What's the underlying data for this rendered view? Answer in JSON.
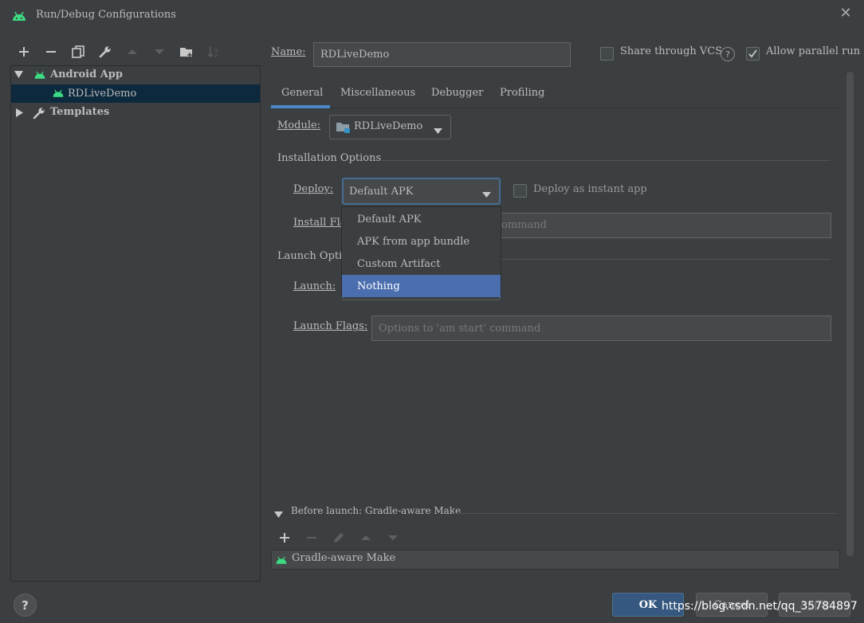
{
  "window": {
    "title": "Run/Debug Configurations"
  },
  "tree": {
    "group_label": "Android App",
    "item_label": "RDLiveDemo",
    "templates_label": "Templates"
  },
  "header": {
    "name_label": "Name:",
    "name_value": "RDLiveDemo",
    "share_vcs_label": "Share through VCS",
    "share_vcs_checked": false,
    "allow_parallel_label": "Allow parallel run",
    "allow_parallel_checked": true
  },
  "tabs": [
    {
      "label": "General",
      "active": true
    },
    {
      "label": "Miscellaneous",
      "active": false
    },
    {
      "label": "Debugger",
      "active": false
    },
    {
      "label": "Profiling",
      "active": false
    }
  ],
  "general": {
    "module_label": "Module:",
    "module_value": "RDLiveDemo",
    "installation_options_label": "Installation Options",
    "deploy_label": "Deploy:",
    "deploy_value": "Default APK",
    "deploy_instant_label": "Deploy as instant app",
    "install_flags_label": "Install Fla",
    "install_flags_placeholder_tail": "ommand",
    "launch_options_label": "Launch Optio",
    "launch_label": "Launch:",
    "launch_flags_label": "Launch Flags:",
    "launch_flags_placeholder": "Options to 'am start' command",
    "deploy_options": [
      "Default APK",
      "APK from app bundle",
      "Custom Artifact",
      "Nothing"
    ],
    "deploy_options_selected": "Nothing"
  },
  "before_launch": {
    "title": "Before launch: Gradle-aware Make",
    "tasks": [
      "Gradle-aware Make"
    ]
  },
  "buttons": {
    "ok": "OK",
    "cancel": "Cancel",
    "apply": "Apply",
    "help": "?"
  },
  "watermark": "https://blog.csdn.net/qq_35784897",
  "colors": {
    "background": "#3c3f41",
    "selection": "#0d293e",
    "popup_selection": "#4b6eaf",
    "android_green": "#3ddc84",
    "tab_underline": "#4a88c7",
    "ok_button": "#365880"
  }
}
